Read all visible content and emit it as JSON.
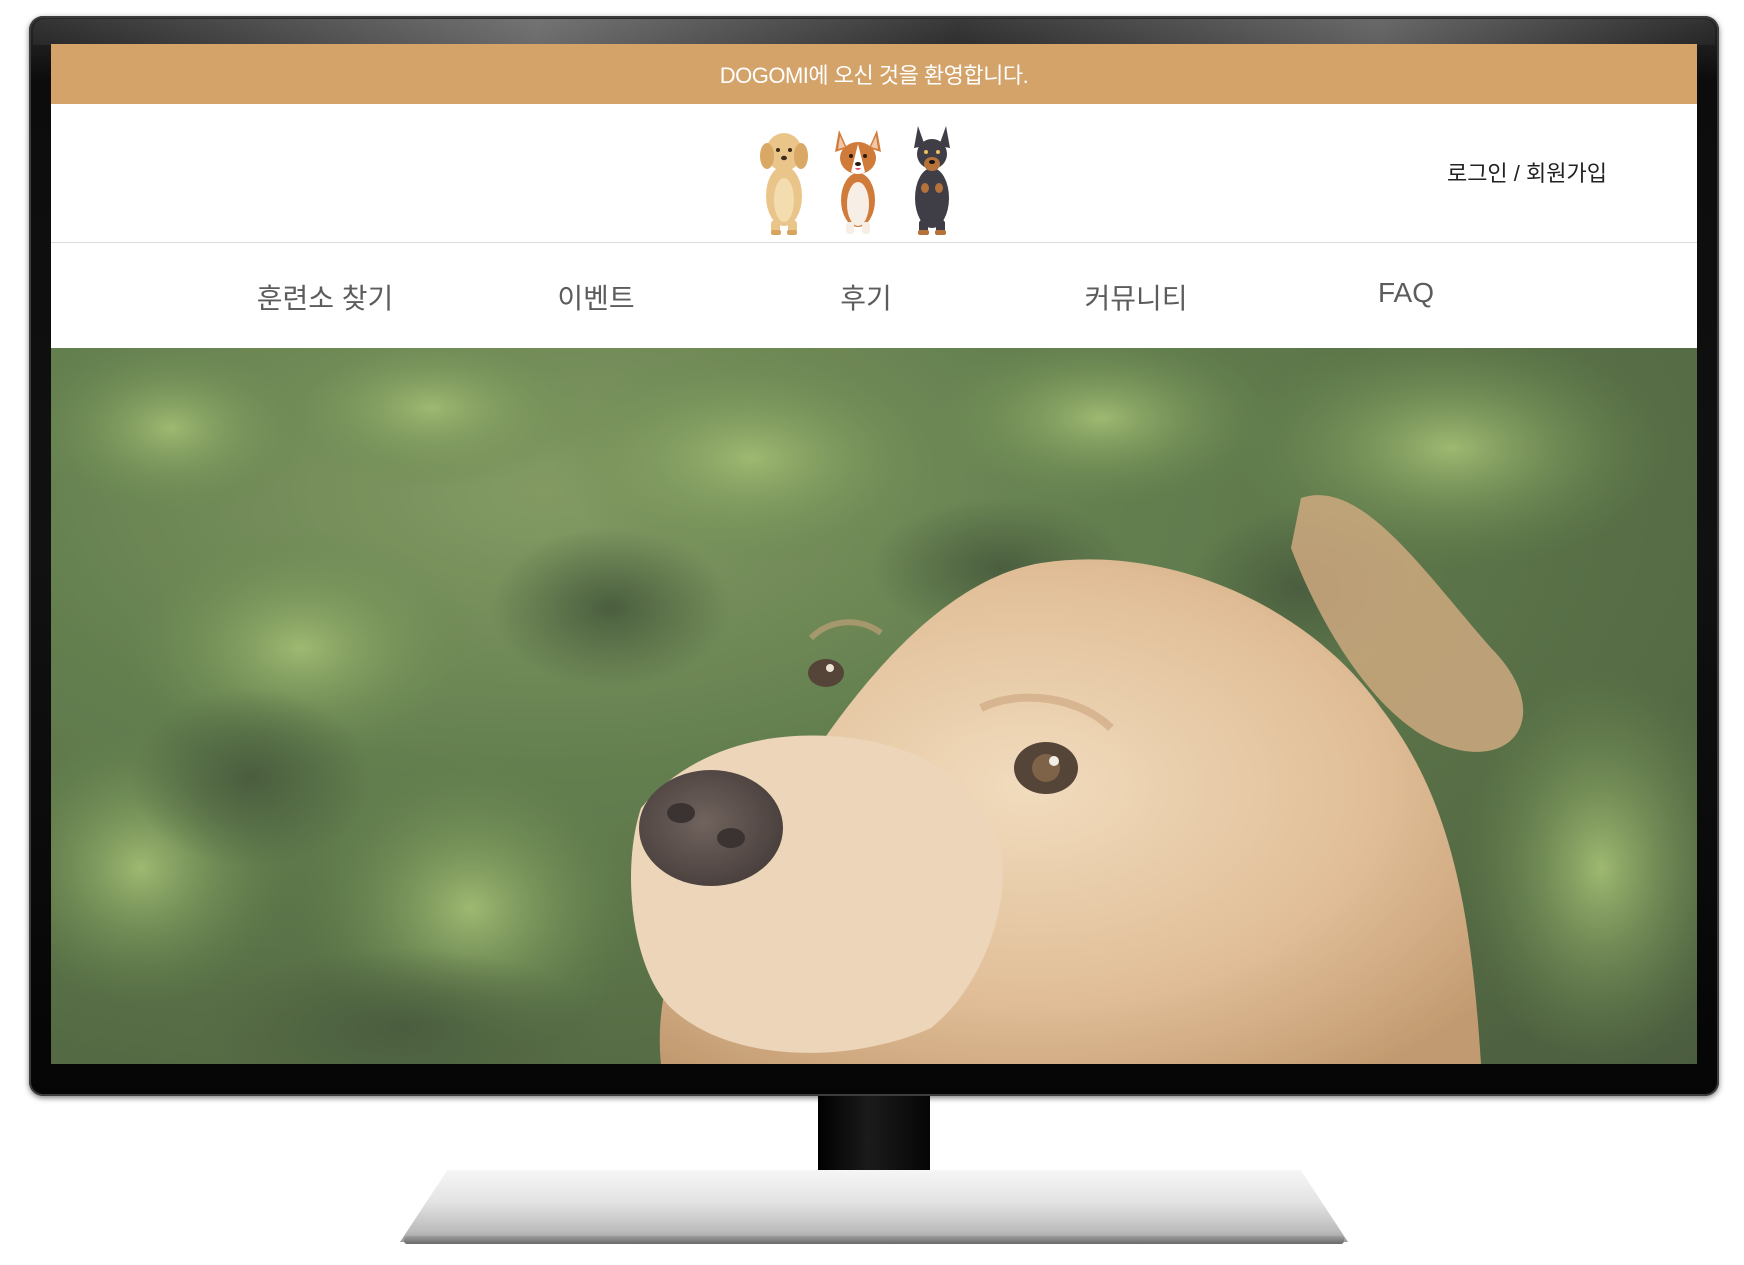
{
  "top_banner": {
    "text": "DOGOMI에 오신 것을 환영합니다."
  },
  "header": {
    "logo_icons": [
      "golden-retriever-icon",
      "corgi-icon",
      "doberman-icon"
    ],
    "auth": {
      "login": "로그인",
      "separator": " / ",
      "signup": "회원가입"
    }
  },
  "nav": {
    "items": [
      {
        "label": "훈련소 찾기"
      },
      {
        "label": "이벤트"
      },
      {
        "label": "후기"
      },
      {
        "label": "커뮤니티"
      },
      {
        "label": "FAQ"
      }
    ]
  },
  "hero": {
    "image": "golden-retriever-in-grass-photo"
  },
  "colors": {
    "banner": "#d4a36a",
    "nav_text": "#5c5c5c",
    "auth_text": "#222222"
  }
}
